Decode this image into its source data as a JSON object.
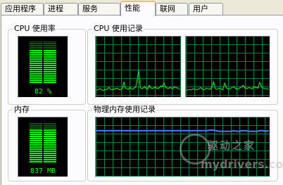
{
  "tabs": [
    "应用程序",
    "进程",
    "服务",
    "性能",
    "联网",
    "用户"
  ],
  "active_tab": "性能",
  "cpu_usage": {
    "title": "CPU 使用率",
    "value_label": "82 %",
    "level": 0.82
  },
  "cpu_history": {
    "title": "CPU 使用记录",
    "graph1": [
      10,
      10,
      11,
      12,
      10,
      9,
      11,
      10,
      12,
      14,
      11,
      10,
      12,
      11,
      13,
      12,
      10,
      11,
      12,
      24,
      13,
      12,
      11,
      14,
      12,
      11,
      13,
      15,
      28,
      44,
      14,
      12,
      13,
      16,
      12,
      11,
      18,
      14,
      12,
      13,
      15,
      13,
      12,
      14,
      17,
      16,
      22,
      15,
      13,
      12,
      14,
      13,
      12,
      16,
      14,
      13,
      12,
      11
    ],
    "graph2": [
      9,
      10,
      11,
      10,
      12,
      11,
      10,
      12,
      14,
      11,
      10,
      13,
      12,
      11,
      14,
      24,
      12,
      11,
      13,
      12,
      10,
      22,
      13,
      11,
      12,
      14,
      16,
      12,
      11,
      13,
      15,
      18,
      13,
      12,
      14,
      13,
      12,
      16,
      14,
      13,
      23,
      15,
      13,
      12,
      12,
      11
    ]
  },
  "memory": {
    "title": "内存",
    "value_label": "837 MB",
    "level": 0.82
  },
  "memory_history": {
    "title": "物理内存使用记录",
    "line": [
      79,
      79,
      79,
      79,
      79,
      79,
      79,
      79,
      79,
      79,
      79,
      79,
      79,
      79,
      79,
      79,
      79,
      79,
      79,
      79,
      79,
      79,
      79,
      79,
      79,
      79,
      79,
      79,
      79,
      79,
      79,
      79,
      79,
      79,
      79,
      79,
      79,
      79,
      79,
      80,
      80,
      79,
      78,
      78,
      78,
      78,
      78,
      79,
      78,
      78,
      79,
      79,
      78,
      78,
      78,
      78,
      79,
      79,
      78,
      79
    ]
  },
  "watermark": {
    "line1": "驱动之家",
    "line2": "mydrivers.com"
  }
}
